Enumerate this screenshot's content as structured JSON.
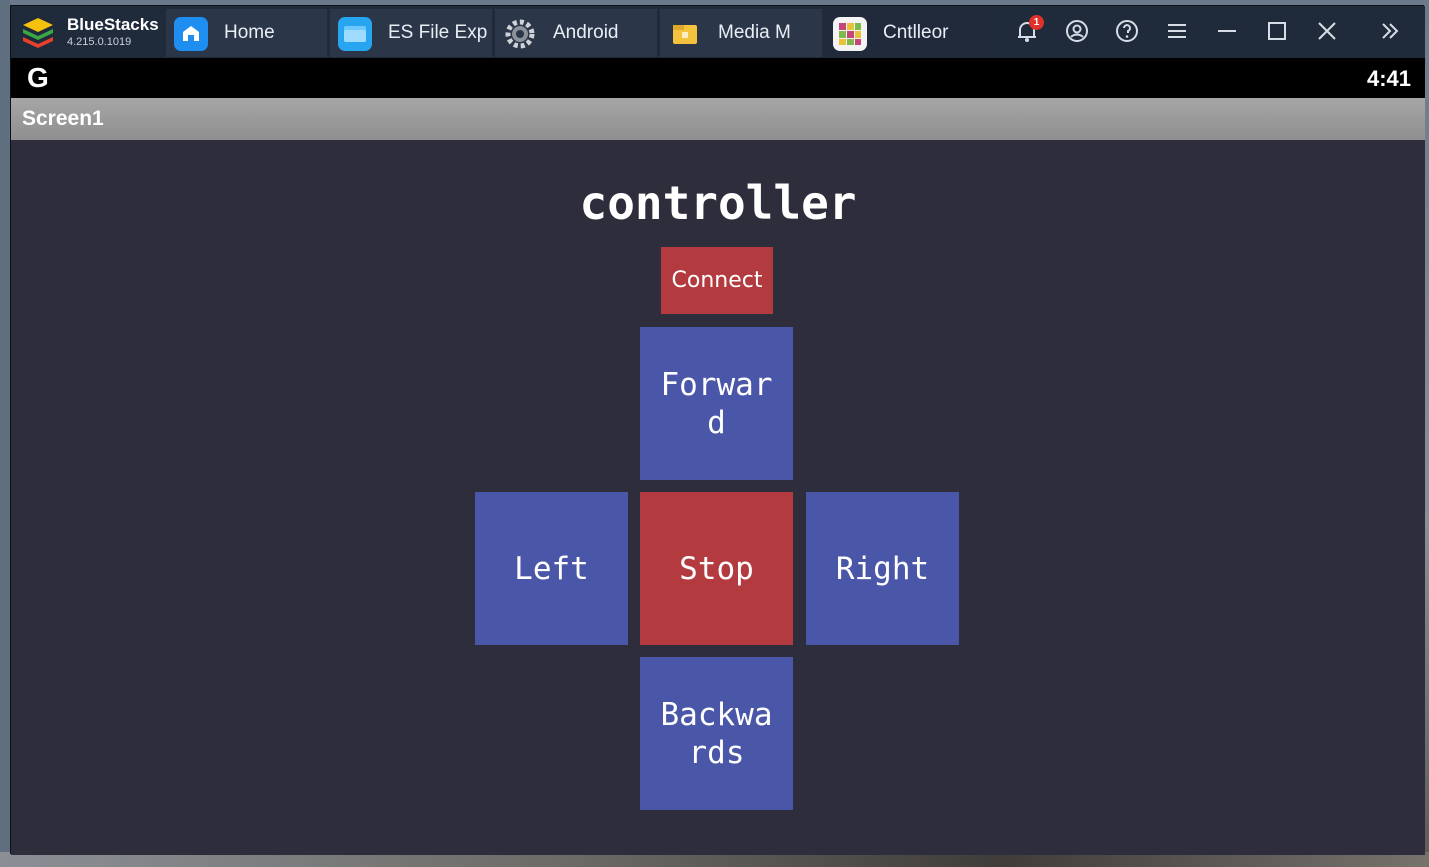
{
  "titlebar": {
    "brand_name": "BlueStacks",
    "brand_version": "4.215.0.1019",
    "tabs": [
      {
        "label": "Home",
        "icon": "home-icon"
      },
      {
        "label": "ES File Expl",
        "icon": "folder-app-icon"
      },
      {
        "label": "Android",
        "icon": "gear-icon"
      },
      {
        "label": "Media M",
        "icon": "media-manager-icon"
      },
      {
        "label": "Cntlleor",
        "icon": "app-icon",
        "active": true
      }
    ],
    "notification_count": "1"
  },
  "statusbar": {
    "left_icon": "G",
    "time": "4:41"
  },
  "appbar": {
    "title": "Screen1"
  },
  "controller": {
    "title": "controller",
    "connect_label": "Connect",
    "forward_label": "Forwar d",
    "left_label": "Left",
    "stop_label": "Stop",
    "right_label": "Right",
    "backwards_label": "Backwa rds"
  },
  "colors": {
    "button_blue": "#4a56a8",
    "button_red": "#b33b3f",
    "screen_bg": "#2e2d3b"
  }
}
